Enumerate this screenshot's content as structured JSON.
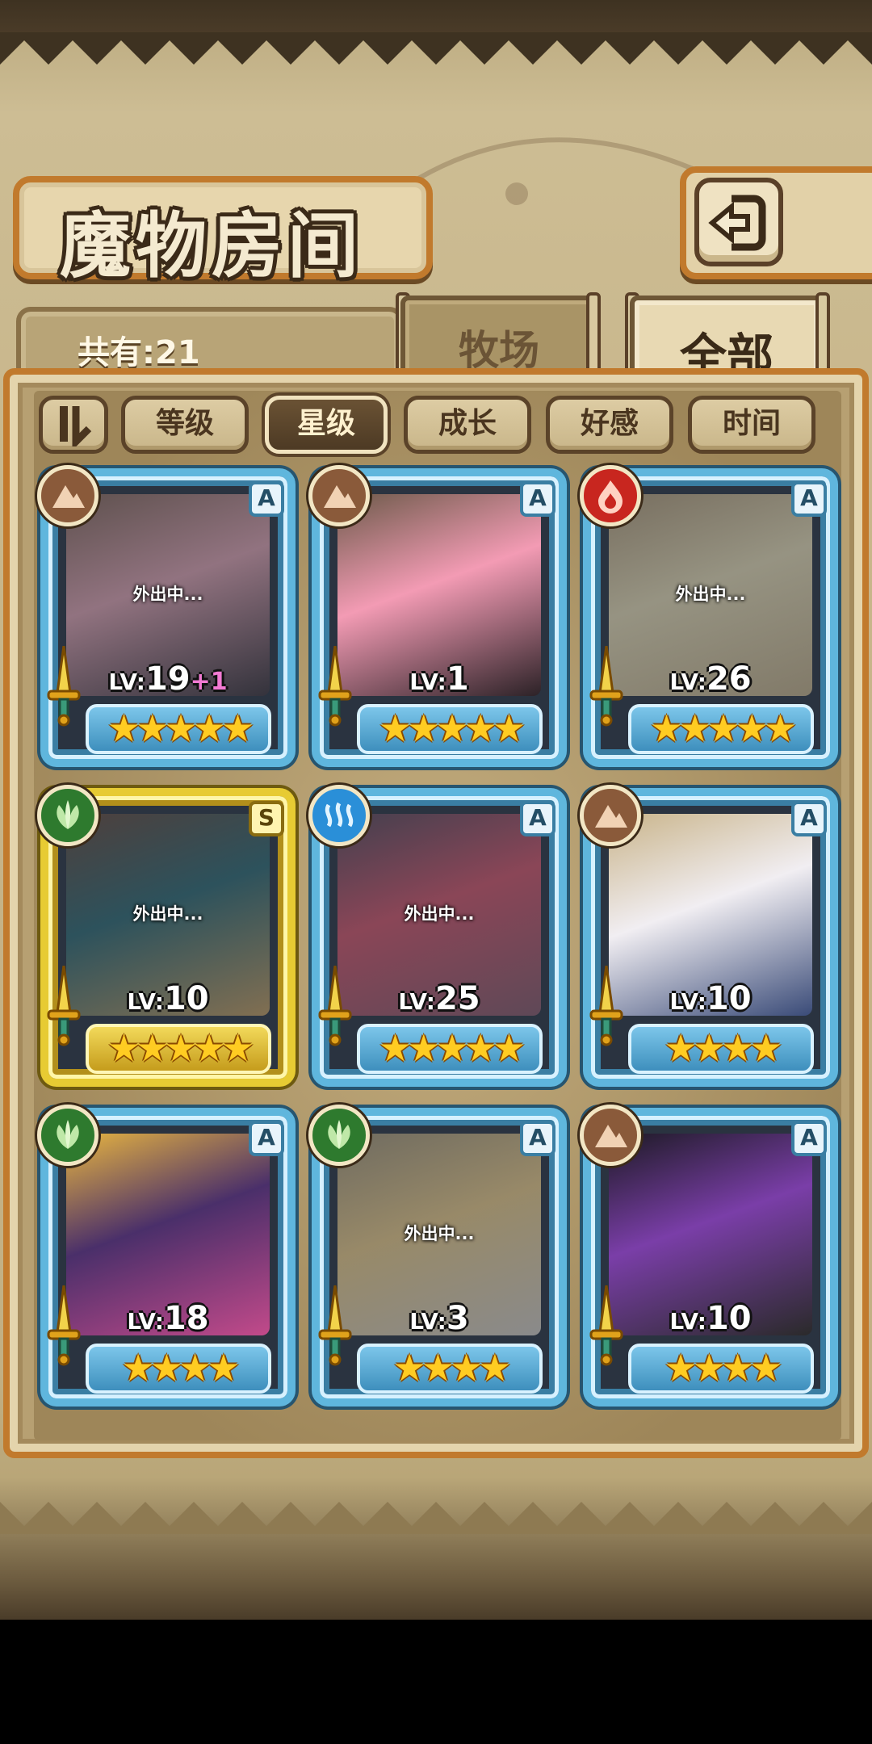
{
  "title": "魔物房间",
  "count_text": "共有:21",
  "tabs": {
    "pasture": "牧场",
    "all": "全部"
  },
  "sort": {
    "level": "等级",
    "star": "星级",
    "growth": "成长",
    "affinity": "好感",
    "time": "时间"
  },
  "away_label": "外出中...",
  "cards": [
    {
      "level": "19",
      "bonus": "+1",
      "rank": "A",
      "element": "earth",
      "stars": "★★★★★",
      "away": true
    },
    {
      "level": "1",
      "bonus": "",
      "rank": "A",
      "element": "earth",
      "stars": "★★★★★",
      "away": false
    },
    {
      "level": "26",
      "bonus": "",
      "rank": "A",
      "element": "fire",
      "stars": "★★★★★",
      "away": true
    },
    {
      "level": "10",
      "bonus": "",
      "rank": "S",
      "element": "nature",
      "stars": "★★★★★",
      "away": true
    },
    {
      "level": "25",
      "bonus": "",
      "rank": "A",
      "element": "water",
      "stars": "★★★★★",
      "away": true
    },
    {
      "level": "10",
      "bonus": "",
      "rank": "A",
      "element": "earth",
      "stars": "★★★★",
      "away": false
    },
    {
      "level": "18",
      "bonus": "",
      "rank": "A",
      "element": "nature",
      "stars": "★★★★",
      "away": false
    },
    {
      "level": "3",
      "bonus": "",
      "rank": "A",
      "element": "nature",
      "stars": "★★★★",
      "away": true
    },
    {
      "level": "10",
      "bonus": "",
      "rank": "A",
      "element": "earth",
      "stars": "★★★★",
      "away": false
    }
  ],
  "lv_prefix": "LV:",
  "colors": {
    "frame_blue": "#5fb6dd",
    "frame_gold": "#e7cb33",
    "earth": "#8a5a3a",
    "fire": "#c8261f",
    "nature": "#2e7a2e",
    "water": "#2a8fd8"
  }
}
